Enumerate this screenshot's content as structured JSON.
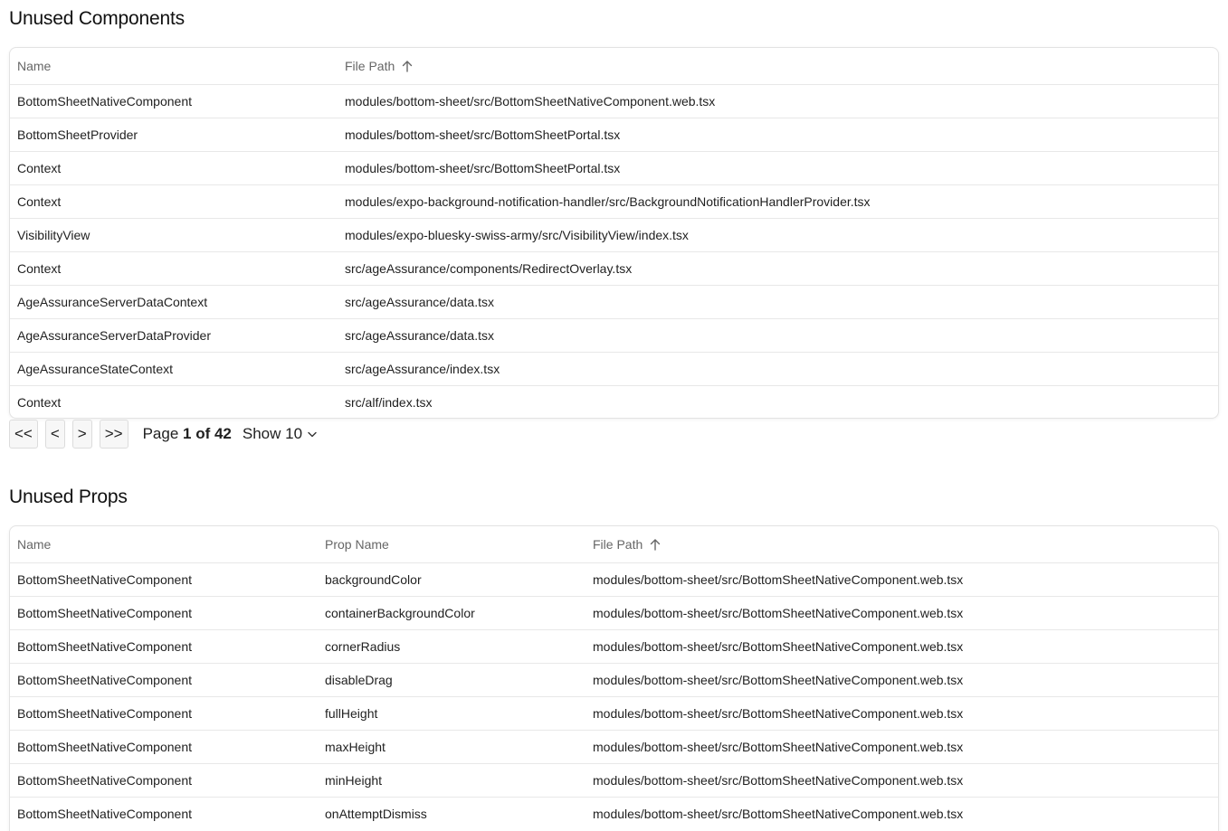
{
  "components": {
    "title": "Unused Components",
    "columns": {
      "name": "Name",
      "file_path": "File Path"
    },
    "rows": [
      {
        "name": "BottomSheetNativeComponent",
        "file_path": "modules/bottom-sheet/src/BottomSheetNativeComponent.web.tsx"
      },
      {
        "name": "BottomSheetProvider",
        "file_path": "modules/bottom-sheet/src/BottomSheetPortal.tsx"
      },
      {
        "name": "Context",
        "file_path": "modules/bottom-sheet/src/BottomSheetPortal.tsx"
      },
      {
        "name": "Context",
        "file_path": "modules/expo-background-notification-handler/src/BackgroundNotificationHandlerProvider.tsx"
      },
      {
        "name": "VisibilityView",
        "file_path": "modules/expo-bluesky-swiss-army/src/VisibilityView/index.tsx"
      },
      {
        "name": "Context",
        "file_path": "src/ageAssurance/components/RedirectOverlay.tsx"
      },
      {
        "name": "AgeAssuranceServerDataContext",
        "file_path": "src/ageAssurance/data.tsx"
      },
      {
        "name": "AgeAssuranceServerDataProvider",
        "file_path": "src/ageAssurance/data.tsx"
      },
      {
        "name": "AgeAssuranceStateContext",
        "file_path": "src/ageAssurance/index.tsx"
      },
      {
        "name": "Context",
        "file_path": "src/alf/index.tsx"
      }
    ],
    "sort_icon": "arrow-up-icon"
  },
  "pagination": {
    "first": "<<",
    "prev": "<",
    "next": ">",
    "last": ">>",
    "page_prefix": "Page",
    "page_bold": "1 of 42",
    "show_label": "Show 10",
    "show_icon": "chevron-down-icon"
  },
  "props": {
    "title": "Unused Props",
    "columns": {
      "name": "Name",
      "prop_name": "Prop Name",
      "file_path": "File Path"
    },
    "rows": [
      {
        "name": "BottomSheetNativeComponent",
        "prop_name": "backgroundColor",
        "file_path": "modules/bottom-sheet/src/BottomSheetNativeComponent.web.tsx"
      },
      {
        "name": "BottomSheetNativeComponent",
        "prop_name": "containerBackgroundColor",
        "file_path": "modules/bottom-sheet/src/BottomSheetNativeComponent.web.tsx"
      },
      {
        "name": "BottomSheetNativeComponent",
        "prop_name": "cornerRadius",
        "file_path": "modules/bottom-sheet/src/BottomSheetNativeComponent.web.tsx"
      },
      {
        "name": "BottomSheetNativeComponent",
        "prop_name": "disableDrag",
        "file_path": "modules/bottom-sheet/src/BottomSheetNativeComponent.web.tsx"
      },
      {
        "name": "BottomSheetNativeComponent",
        "prop_name": "fullHeight",
        "file_path": "modules/bottom-sheet/src/BottomSheetNativeComponent.web.tsx"
      },
      {
        "name": "BottomSheetNativeComponent",
        "prop_name": "maxHeight",
        "file_path": "modules/bottom-sheet/src/BottomSheetNativeComponent.web.tsx"
      },
      {
        "name": "BottomSheetNativeComponent",
        "prop_name": "minHeight",
        "file_path": "modules/bottom-sheet/src/BottomSheetNativeComponent.web.tsx"
      },
      {
        "name": "BottomSheetNativeComponent",
        "prop_name": "onAttemptDismiss",
        "file_path": "modules/bottom-sheet/src/BottomSheetNativeComponent.web.tsx"
      }
    ],
    "sort_icon": "arrow-up-icon"
  }
}
